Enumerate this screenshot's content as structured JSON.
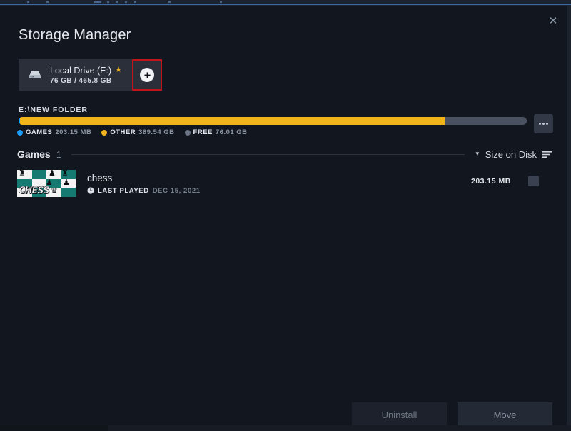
{
  "window": {
    "close_icon": "close-icon"
  },
  "header": {
    "title": "Storage Manager"
  },
  "drive_selector": {
    "drive_icon": "hard-drive-icon",
    "label": "Local Drive (E:)",
    "star_icon": "star-icon",
    "capacity": "76 GB / 465.8 GB",
    "add_drive_icon": "plus-circle-icon",
    "highlight_color": "#c0141b"
  },
  "storage": {
    "path": "E:\\NEW FOLDER",
    "menu_icon": "ellipsis-icon",
    "bar": {
      "games_pct": 0.04,
      "other_pct": 83.6,
      "free_pct": 16.36
    },
    "legend": [
      {
        "name": "GAMES",
        "value": "203.15 MB",
        "color": "#1a9fff"
      },
      {
        "name": "OTHER",
        "value": "389.54 GB",
        "color": "#f0b419"
      },
      {
        "name": "FREE",
        "value": "76.01 GB",
        "color": "#6b7585"
      }
    ]
  },
  "games_section": {
    "title": "Games",
    "count": "1",
    "sort": {
      "caret_icon": "chevron-down-icon",
      "label": "Size on Disk",
      "sort_icon": "sort-descending-icon"
    }
  },
  "game": {
    "thumbnail_name": "chess-board-thumbnail",
    "thumbnail_wordmark": "CHESS",
    "title": "chess",
    "clock_icon": "clock-icon",
    "meta_label": "LAST PLAYED",
    "meta_value": "DEC 15, 2021",
    "size": "203.15 MB",
    "checkbox_checked": false
  },
  "footer": {
    "uninstall_label": "Uninstall",
    "move_label": "Move"
  }
}
